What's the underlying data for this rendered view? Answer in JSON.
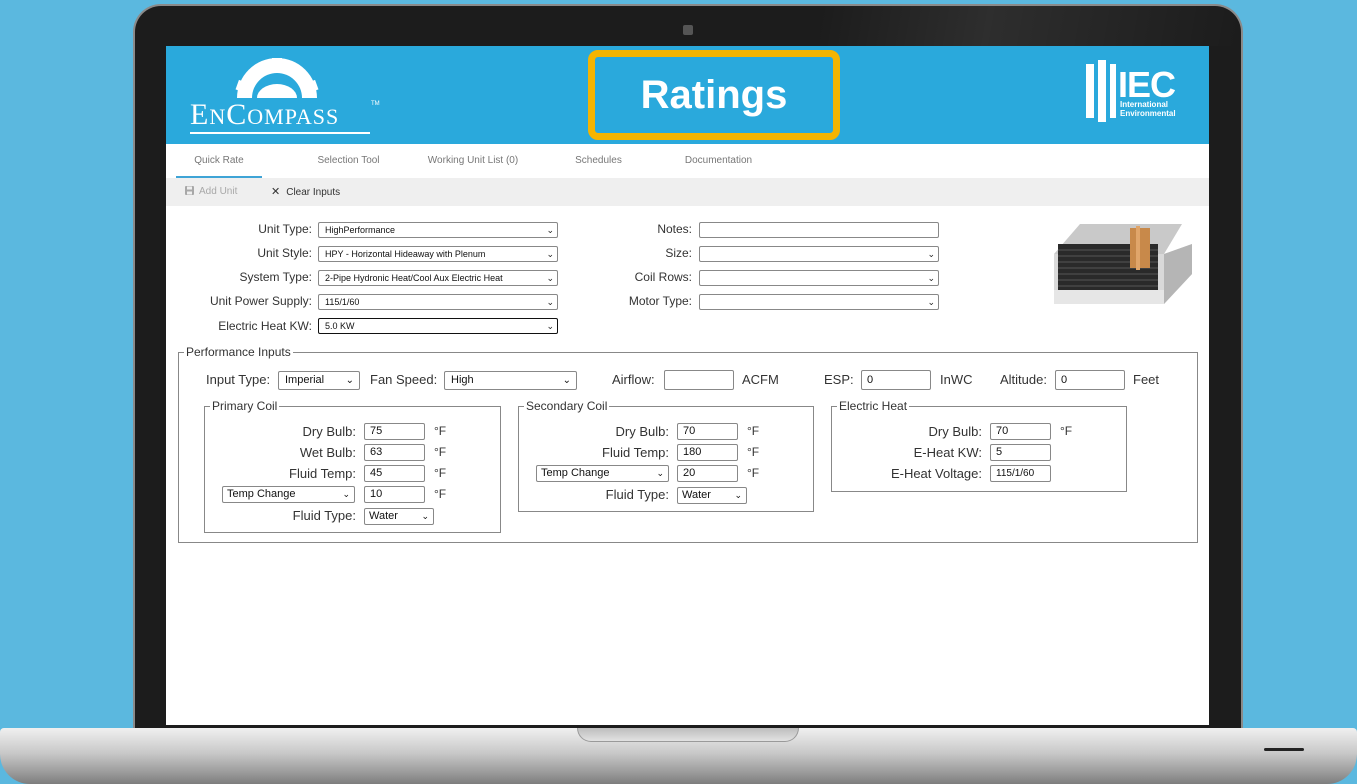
{
  "header": {
    "logo_main": "EnCompass",
    "logo_tm": "TM",
    "title": "Ratings",
    "brand_abbr": "IEC",
    "brand_line1": "International",
    "brand_line2": "Environmental"
  },
  "tabs": [
    {
      "label": "Quick Rate",
      "active": true
    },
    {
      "label": "Selection Tool"
    },
    {
      "label": "Working Unit List (0)"
    },
    {
      "label": "Schedules"
    },
    {
      "label": "Documentation"
    }
  ],
  "toolbar": {
    "add_unit": "Add Unit",
    "clear_inputs": "Clear Inputs"
  },
  "unit_form": {
    "unit_type": {
      "label": "Unit Type:",
      "value": "HighPerformance"
    },
    "unit_style": {
      "label": "Unit Style:",
      "value": "HPY - Horizontal Hideaway with Plenum"
    },
    "system_type": {
      "label": "System Type:",
      "value": "2-Pipe Hydronic Heat/Cool Aux Electric Heat"
    },
    "power_supply": {
      "label": "Unit Power Supply:",
      "value": "115/1/60"
    },
    "electric_heat_kw": {
      "label": "Electric Heat KW:",
      "value": "5.0 KW"
    },
    "notes": {
      "label": "Notes:",
      "value": ""
    },
    "size": {
      "label": "Size:",
      "value": ""
    },
    "coil_rows": {
      "label": "Coil Rows:",
      "value": ""
    },
    "motor_type": {
      "label": "Motor Type:",
      "value": ""
    }
  },
  "performance": {
    "legend": "Performance Inputs",
    "input_type": {
      "label": "Input Type:",
      "value": "Imperial"
    },
    "fan_speed": {
      "label": "Fan Speed:",
      "value": "High"
    },
    "airflow": {
      "label": "Airflow:",
      "value": "",
      "unit": "ACFM"
    },
    "esp": {
      "label": "ESP:",
      "value": "0",
      "unit": "InWC"
    },
    "altitude": {
      "label": "Altitude:",
      "value": "0",
      "unit": "Feet"
    }
  },
  "primary_coil": {
    "legend": "Primary Coil",
    "dry_bulb": {
      "label": "Dry Bulb:",
      "value": "75",
      "unit": "°F"
    },
    "wet_bulb": {
      "label": "Wet Bulb:",
      "value": "63",
      "unit": "°F"
    },
    "fluid_temp": {
      "label": "Fluid Temp:",
      "value": "45",
      "unit": "°F"
    },
    "mode": {
      "value": "Temp Change",
      "amount": "10",
      "unit": "°F"
    },
    "fluid_type": {
      "label": "Fluid Type:",
      "value": "Water"
    }
  },
  "secondary_coil": {
    "legend": "Secondary Coil",
    "dry_bulb": {
      "label": "Dry Bulb:",
      "value": "70",
      "unit": "°F"
    },
    "fluid_temp": {
      "label": "Fluid Temp:",
      "value": "180",
      "unit": "°F"
    },
    "mode": {
      "value": "Temp Change",
      "amount": "20",
      "unit": "°F"
    },
    "fluid_type": {
      "label": "Fluid Type:",
      "value": "Water"
    }
  },
  "electric_heat": {
    "legend": "Electric Heat",
    "dry_bulb": {
      "label": "Dry Bulb:",
      "value": "70",
      "unit": "°F"
    },
    "eheat_kw": {
      "label": "E-Heat KW:",
      "value": "5"
    },
    "eheat_voltage": {
      "label": "E-Heat Voltage:",
      "value": "115/1/60"
    }
  },
  "icons": {
    "save": "save-icon",
    "clear": "close-icon",
    "dropdown": "chevron-down-icon"
  },
  "colors": {
    "header_bg": "#2aa9dc",
    "title_border": "#f5b400",
    "page_bg": "#5bb8df"
  }
}
